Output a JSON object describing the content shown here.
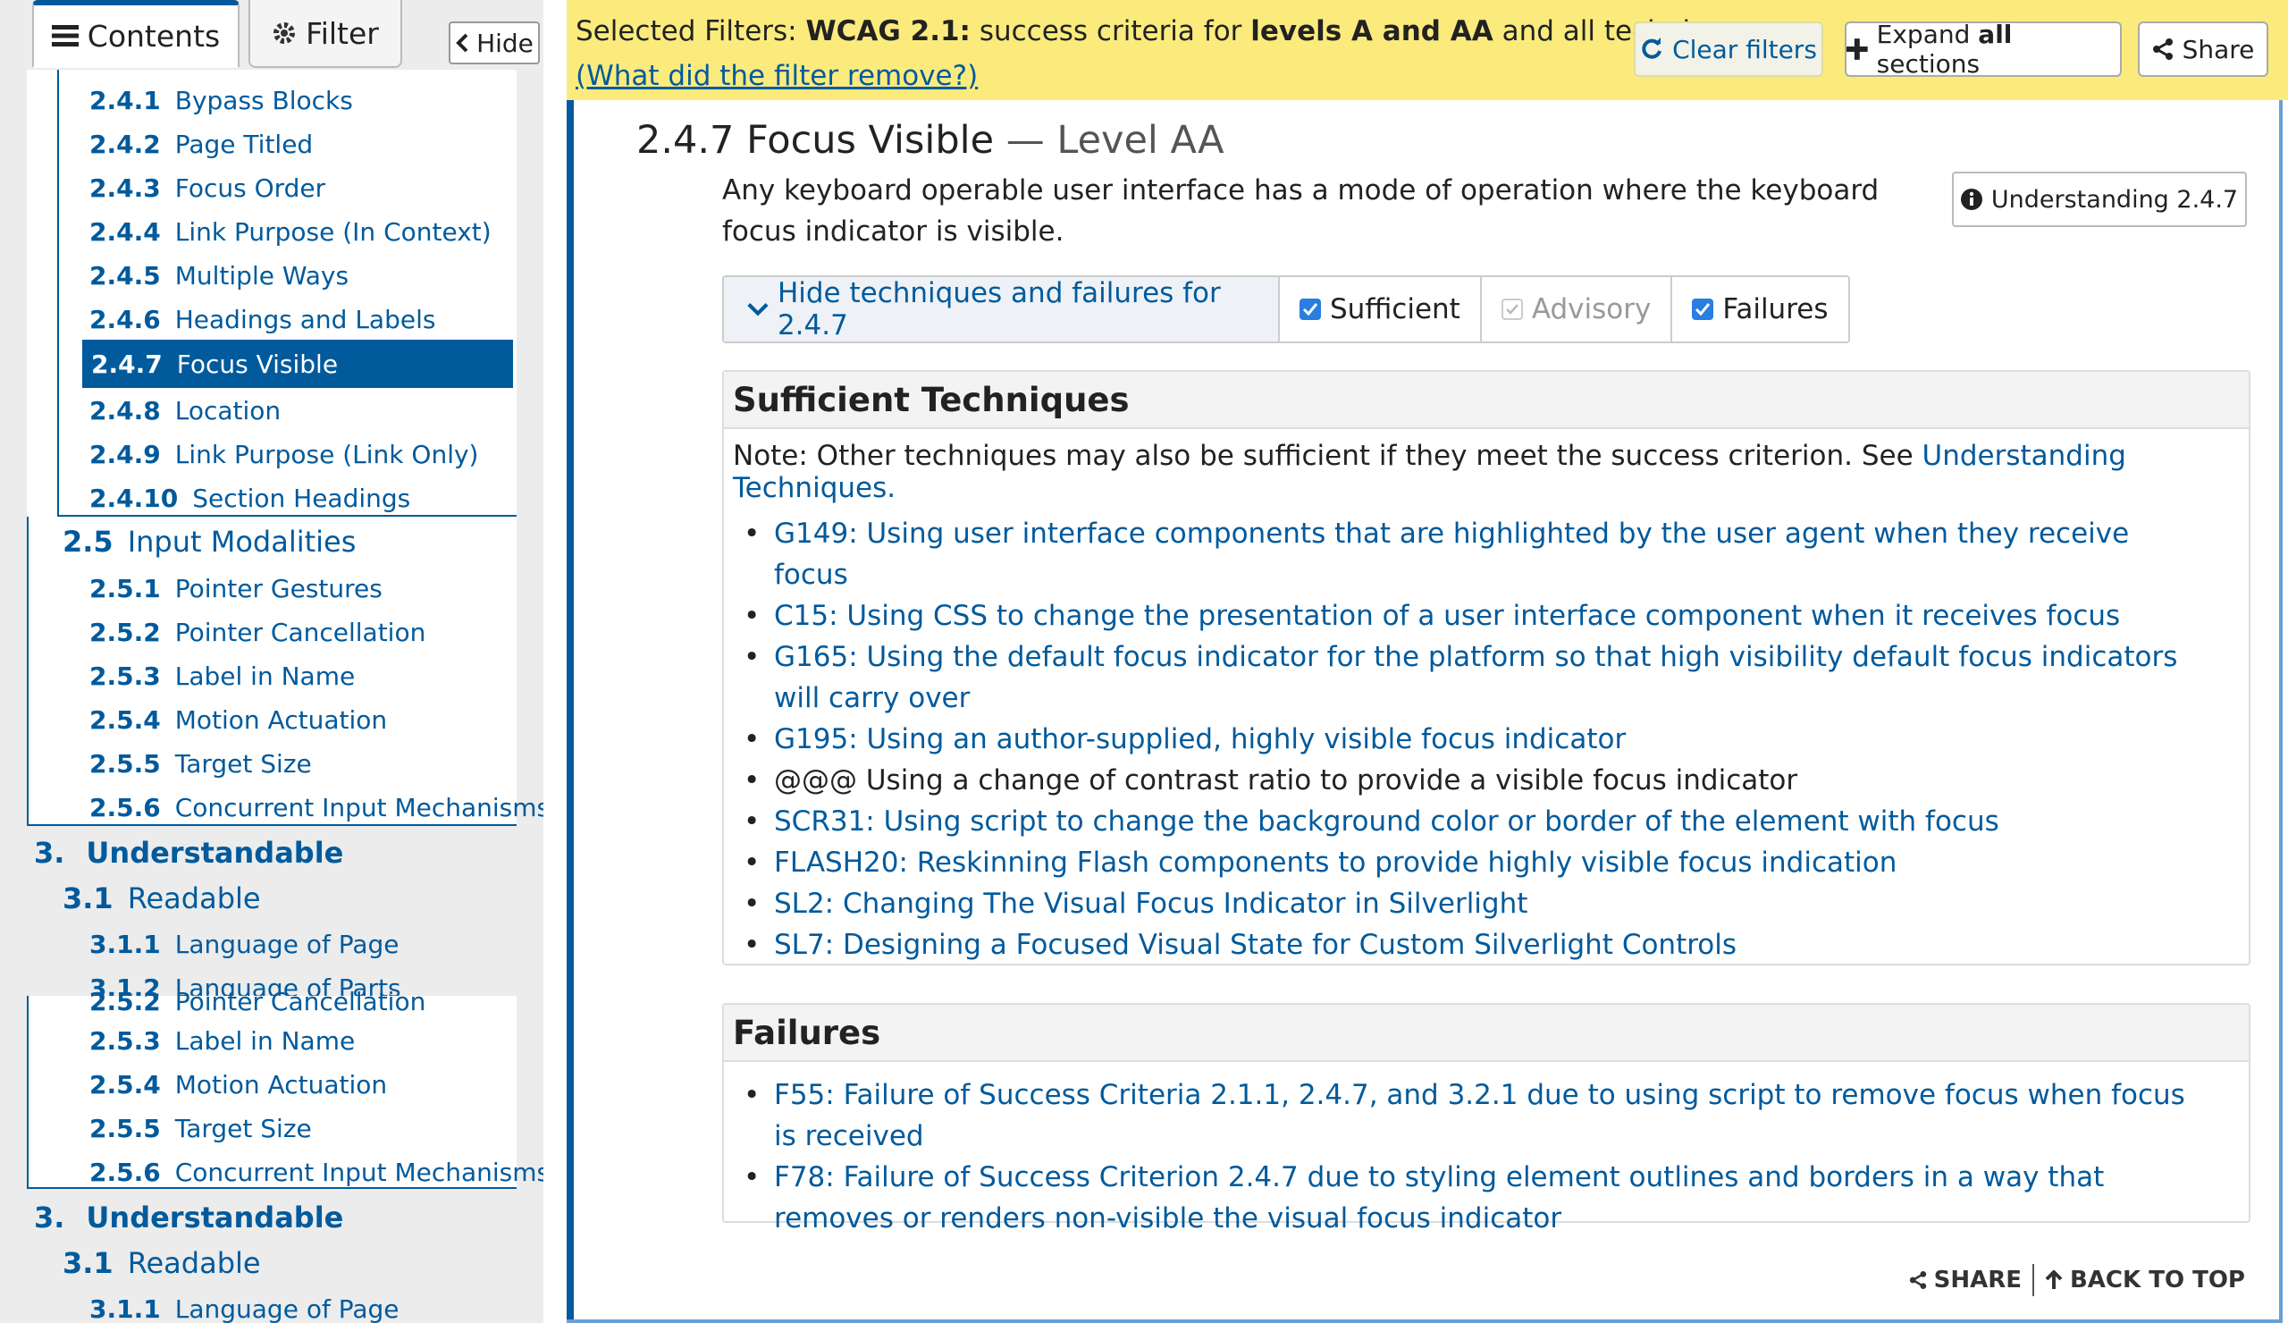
{
  "sidebar": {
    "tabs": [
      {
        "label": "Contents",
        "icon": "list-icon"
      },
      {
        "label": "Filter",
        "icon": "gear-icon"
      }
    ],
    "hide_label": "Hide",
    "toc_top": [
      {
        "num": "2.4.1",
        "label": "Bypass Blocks"
      },
      {
        "num": "2.4.2",
        "label": "Page Titled"
      },
      {
        "num": "2.4.3",
        "label": "Focus Order"
      },
      {
        "num": "2.4.4",
        "label": "Link Purpose (In Context)"
      },
      {
        "num": "2.4.5",
        "label": "Multiple Ways"
      },
      {
        "num": "2.4.6",
        "label": "Headings and Labels"
      },
      {
        "num": "2.4.7",
        "label": "Focus Visible",
        "current": true
      },
      {
        "num": "2.4.8",
        "label": "Location"
      },
      {
        "num": "2.4.9",
        "label": "Link Purpose (Link Only)"
      },
      {
        "num": "2.4.10",
        "label": "Section Headings"
      },
      {
        "num": "2.5",
        "label": "Input Modalities"
      },
      {
        "num": "2.5.1",
        "label": "Pointer Gestures"
      },
      {
        "num": "2.5.2",
        "label": "Pointer Cancellation"
      },
      {
        "num": "2.5.3",
        "label": "Label in Name"
      },
      {
        "num": "2.5.4",
        "label": "Motion Actuation"
      },
      {
        "num": "2.5.5",
        "label": "Target Size"
      },
      {
        "num": "2.5.6",
        "label": "Concurrent Input Mechanisms"
      },
      {
        "num": "3.",
        "label": "Understandable"
      },
      {
        "num": "3.1",
        "label": "Readable"
      },
      {
        "num": "3.1.1",
        "label": "Language of Page"
      },
      {
        "num": "3.1.2",
        "label": "Language of Parts"
      }
    ],
    "toc_bottom": [
      {
        "num": "2.5.2",
        "label": "Pointer Cancellation"
      },
      {
        "num": "2.5.3",
        "label": "Label in Name"
      },
      {
        "num": "2.5.4",
        "label": "Motion Actuation"
      },
      {
        "num": "2.5.5",
        "label": "Target Size"
      },
      {
        "num": "2.5.6",
        "label": "Concurrent Input Mechanisms"
      },
      {
        "num": "3.",
        "label": "Understandable"
      },
      {
        "num": "3.1",
        "label": "Readable"
      },
      {
        "num": "3.1.1",
        "label": "Language of Page"
      }
    ]
  },
  "filterbar": {
    "prefix": "Selected Filters: ",
    "version": "WCAG 2.1:",
    "middle": " success criteria for ",
    "levels": "levels A and AA",
    "suffix": " and all techniques.",
    "link": "(What did the filter remove?)",
    "clear_label": "Clear filters",
    "expand_pre": "Expand ",
    "expand_bold": "all",
    "expand_post": " sections",
    "share_label": "Share"
  },
  "criterion": {
    "title": "2.4.7 Focus Visible",
    "level": " — Level AA",
    "description": "Any keyboard operable user interface has a mode of operation where the keyboard focus indicator is visible.",
    "understanding_label": "Understanding 2.4.7",
    "hide_techniques_label": "Hide techniques and failures for 2.4.7",
    "sufficient_label": "Sufficient",
    "advisory_label": "Advisory",
    "failures_toggle_label": "Failures"
  },
  "sufficient": {
    "heading": "Sufficient Techniques",
    "note_text": "Note: Other techniques may also be sufficient if they meet the success criterion. See ",
    "note_link": "Understanding Techniques.",
    "items": [
      "G149: Using user interface components that are highlighted by the user agent when they receive focus",
      "C15: Using CSS to change the presentation of a user interface component when it receives focus",
      "G165: Using the default focus indicator for the platform so that high visibility default focus indicators will carry over",
      "G195: Using an author-supplied, highly visible focus indicator",
      "@@@ Using a change of contrast ratio to provide a visible focus indicator",
      "SCR31: Using script to change the background color or border of the element with focus",
      "FLASH20: Reskinning Flash components to provide highly visible focus indication",
      "SL2: Changing The Visual Focus Indicator in Silverlight",
      "SL7: Designing a Focused Visual State for Custom Silverlight Controls"
    ]
  },
  "failures": {
    "heading": "Failures",
    "items": [
      "F55: Failure of Success Criteria 2.1.1, 2.4.7, and 3.2.1 due to using script to remove focus when focus is received",
      "F78: Failure of Success Criterion 2.4.7 due to styling element outlines and borders in a way that removes or renders non-visible the visual focus indicator"
    ]
  },
  "footer": {
    "share_label": "SHARE",
    "top_label": "BACK TO TOP"
  },
  "colors": {
    "link": "#005a9c",
    "filterbar_bg": "#fbeb7d",
    "current_bg": "#005a9c",
    "checkbox": "#2a7de1"
  }
}
